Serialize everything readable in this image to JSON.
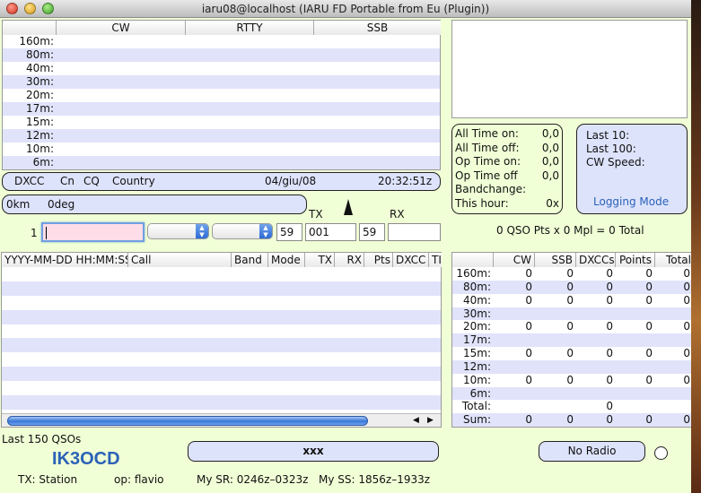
{
  "window": {
    "title": "iaru08@localhost (IARU FD Portable from Eu (Plugin))"
  },
  "band_grid": {
    "headers": [
      "CW",
      "RTTY",
      "SSB"
    ],
    "bands": [
      "160m:",
      "80m:",
      "40m:",
      "30m:",
      "20m:",
      "17m:",
      "15m:",
      "12m:",
      "10m:",
      "6m:"
    ]
  },
  "info_bar": {
    "dxcc": "DXCC",
    "cn": "Cn",
    "cq": "CQ",
    "country": "Country",
    "date": "04/giu/08",
    "time": "20:32:51z"
  },
  "distance_bar": {
    "distance": "0km",
    "bearing": "0deg"
  },
  "time_panel": {
    "rows": [
      {
        "label": "All Time on:",
        "value": "0,0"
      },
      {
        "label": "All Time off:",
        "value": "0,0"
      },
      {
        "label": "Op Time on:",
        "value": "0,0"
      },
      {
        "label": "Op Time off",
        "value": "0,0"
      },
      {
        "label": "Bandchange:",
        "value": ""
      },
      {
        "label": "This hour:",
        "value": "0x"
      }
    ]
  },
  "rate_panel": {
    "last10": "Last 10:",
    "last100": "Last 100:",
    "cw_speed": "CW Speed:",
    "mode_label": "Logging Mode"
  },
  "entry": {
    "row_number": "1",
    "tx_label": "TX",
    "rx_label": "RX",
    "rst_sent": "59",
    "serial_sent": "001",
    "rst_rcvd": "59",
    "serial_rcvd": ""
  },
  "score_line": "0 QSO Pts x 0 Mpl = 0 Total",
  "log_table": {
    "headers": [
      "YYYY-MM-DD HH:MM:SS",
      "Call",
      "Band",
      "Mode",
      "TX",
      "RX",
      "Pts",
      "DXCC",
      "TI"
    ]
  },
  "stats_table": {
    "headers": [
      "CW",
      "SSB",
      "DXCCs",
      "Points",
      "Total"
    ],
    "rows": [
      {
        "band": "160m:",
        "values": [
          "0",
          "0",
          "0",
          "0",
          "0"
        ]
      },
      {
        "band": "80m:",
        "values": [
          "0",
          "0",
          "0",
          "0",
          "0"
        ]
      },
      {
        "band": "40m:",
        "values": [
          "0",
          "0",
          "0",
          "0",
          "0"
        ]
      },
      {
        "band": "30m:",
        "values": [
          "",
          "",
          "",
          "",
          ""
        ]
      },
      {
        "band": "20m:",
        "values": [
          "0",
          "0",
          "0",
          "0",
          "0"
        ]
      },
      {
        "band": "17m:",
        "values": [
          "",
          "",
          "",
          "",
          ""
        ]
      },
      {
        "band": "15m:",
        "values": [
          "0",
          "0",
          "0",
          "0",
          "0"
        ]
      },
      {
        "band": "12m:",
        "values": [
          "",
          "",
          "",
          "",
          ""
        ]
      },
      {
        "band": "10m:",
        "values": [
          "0",
          "0",
          "0",
          "0",
          "0"
        ]
      },
      {
        "band": "6m:",
        "values": [
          "",
          "",
          "",
          "",
          ""
        ]
      },
      {
        "band": "Total:",
        "values": [
          "",
          "",
          "0",
          "",
          ""
        ]
      },
      {
        "band": "Sum:",
        "values": [
          "0",
          "0",
          "0",
          "0",
          "0"
        ]
      }
    ]
  },
  "footer": {
    "last_qsos": "Last 150 QSOs",
    "callsign": "IK3OCD",
    "tx_station": "TX: Station",
    "operator": "op: flavio",
    "my_sr": "My SR: 0246z–0323z",
    "my_ss": "My SS: 1856z–1933z",
    "message_button": "xxx",
    "radio_button": "No Radio"
  },
  "colors": {
    "accent_blue": "#2b62b8",
    "panel": "#dde3fb",
    "background": "#f0ffd6",
    "entry_pink": "#ffdde8"
  }
}
